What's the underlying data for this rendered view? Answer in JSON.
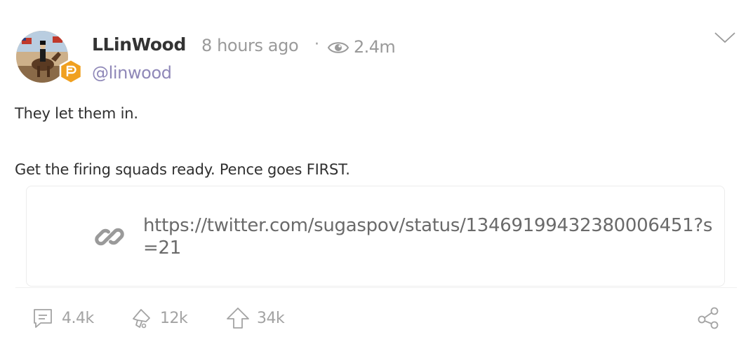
{
  "post": {
    "username": "LLinWood",
    "time": "8 hours ago",
    "separator": "·",
    "views": "2.4m",
    "handle": "@linwood",
    "text_line1": "They let them in.",
    "text_line2": "Get the firing squads ready. Pence goes FIRST.",
    "link_url": "https://twitter.com/sugaspov/status/13469199432380006451?s=21"
  },
  "actions": {
    "comments": "4.4k",
    "echoes": "12k",
    "upvotes": "34k"
  },
  "icons": {
    "badge": "parler-badge-icon",
    "views": "eye-icon",
    "menu": "chevron-down-icon",
    "link": "link-icon",
    "comments": "comment-icon",
    "echo": "echo-icon",
    "upvote": "upvote-icon",
    "share": "share-icon"
  },
  "colors": {
    "badge": "#f0a020",
    "handle": "#8f88b8",
    "meta": "#9a9a9a"
  }
}
